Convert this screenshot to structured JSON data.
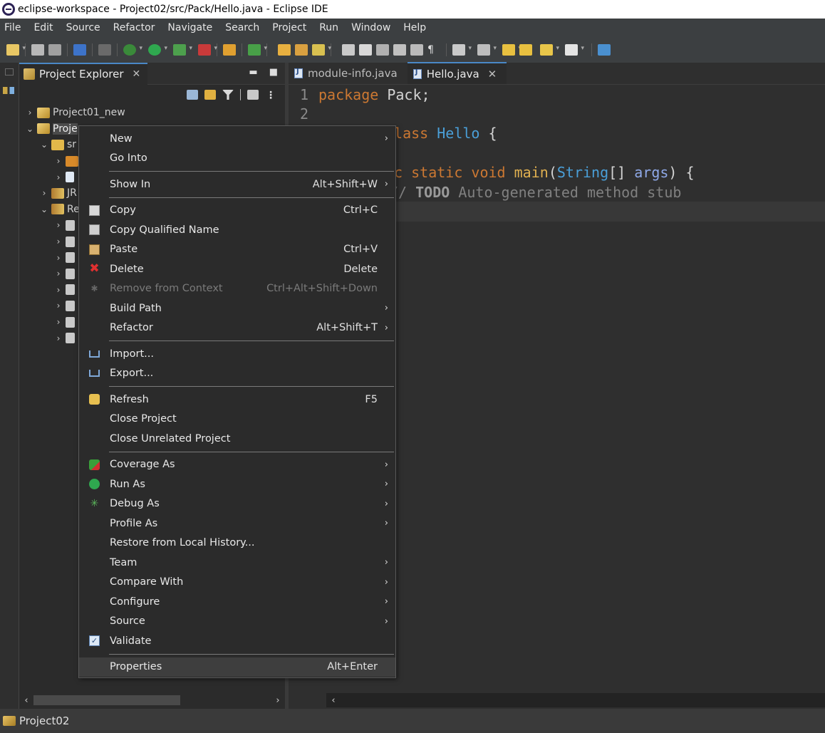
{
  "window": {
    "title": "eclipse-workspace - Project02/src/Pack/Hello.java - Eclipse IDE"
  },
  "menubar": {
    "items": [
      "File",
      "Edit",
      "Source",
      "Refactor",
      "Navigate",
      "Search",
      "Project",
      "Run",
      "Window",
      "Help"
    ]
  },
  "explorer": {
    "tab_label": "Project Explorer",
    "close_glyph": "✕",
    "minimize_glyph": "▬",
    "maximize_glyph": "■",
    "tree": [
      {
        "label": "Project01_new"
      },
      {
        "label": "Proje"
      },
      {
        "label": "sr"
      },
      {
        "label": ""
      },
      {
        "label": ""
      },
      {
        "label": "JR"
      },
      {
        "label": "Re"
      }
    ]
  },
  "editor": {
    "tabs": [
      {
        "label": "module-info.java"
      },
      {
        "label": "Hello.java"
      }
    ],
    "line_numbers": [
      "1",
      "2"
    ],
    "code": {
      "l1_kw": "package",
      "l1_id": " Pack;",
      "l3_kw": "class",
      "l3_ty": " Hello",
      "l3_rest": " {",
      "l5_kw1": "ic static",
      "l5_kw2": " void",
      "l5_fn": " main",
      "l5_p1": "(",
      "l5_ty": "String",
      "l5_p2": "[] ",
      "l5_par": "args",
      "l5_p3": ") {",
      "l6_cmt1": "// ",
      "l6_todo": "TODO",
      "l6_cmt2": " Auto-generated method stub"
    }
  },
  "context_menu": {
    "new": "New",
    "go_into": "Go Into",
    "show_in": "Show In",
    "show_in_sc": "Alt+Shift+W",
    "copy": "Copy",
    "copy_sc": "Ctrl+C",
    "copy_qualified": "Copy Qualified Name",
    "paste": "Paste",
    "paste_sc": "Ctrl+V",
    "delete": "Delete",
    "delete_sc": "Delete",
    "remove_context": "Remove from Context",
    "remove_context_sc": "Ctrl+Alt+Shift+Down",
    "build_path": "Build Path",
    "refactor": "Refactor",
    "refactor_sc": "Alt+Shift+T",
    "import": "Import...",
    "export": "Export...",
    "refresh": "Refresh",
    "refresh_sc": "F5",
    "close_project": "Close Project",
    "close_unrelated": "Close Unrelated Project",
    "coverage_as": "Coverage As",
    "run_as": "Run As",
    "debug_as": "Debug As",
    "profile_as": "Profile As",
    "restore_history": "Restore from Local History...",
    "team": "Team",
    "compare_with": "Compare With",
    "configure": "Configure",
    "source": "Source",
    "validate": "Validate",
    "properties": "Properties",
    "properties_sc": "Alt+Enter",
    "submenu_glyph": "›"
  },
  "statusbar": {
    "text": "Project02"
  },
  "colors": {
    "accent": "#4a88c7",
    "keyword": "#cc7832",
    "type": "#4a9fd8",
    "method": "#e0b050"
  }
}
